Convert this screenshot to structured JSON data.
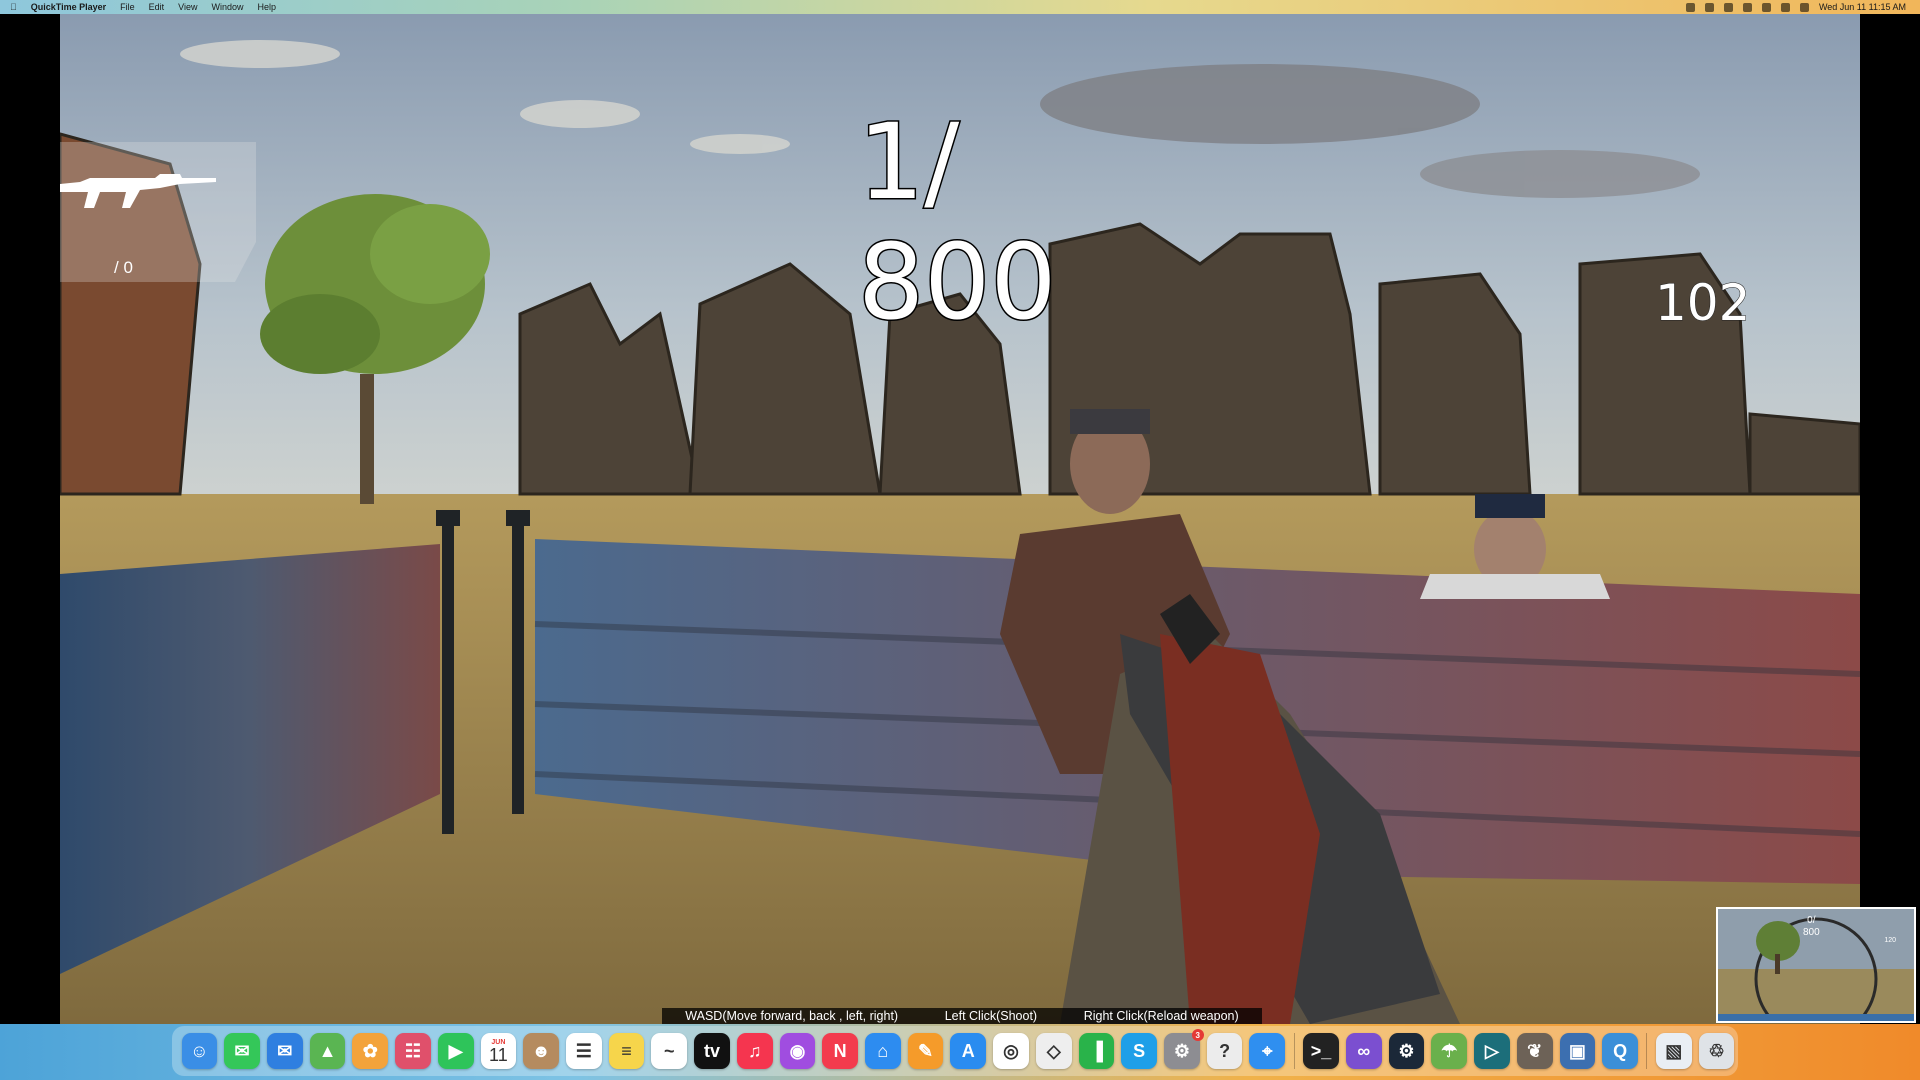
{
  "menubar": {
    "app_name": "QuickTime Player",
    "menus": [
      "File",
      "Edit",
      "View",
      "Window",
      "Help"
    ],
    "datetime": "Wed Jun 11  11:15 AM"
  },
  "hud": {
    "weapon_icon": "assault-rifle-icon",
    "ammo": "/ 0",
    "counter_line1": "1/",
    "counter_line2": "800",
    "kill_count": "102"
  },
  "controls": {
    "move": "WASD(Move forward, back , left, right)",
    "shoot": "Left Click(Shoot)",
    "reload": "Right Click(Reload weapon)"
  },
  "thumbnail": {
    "counter_line1": "0/",
    "counter_line2": "800",
    "kill_count": "120"
  },
  "dock": {
    "calendar_month": "JUN",
    "calendar_day": "11",
    "settings_badge": "3",
    "apps": [
      {
        "name": "finder-icon",
        "color": "#3a8ee6"
      },
      {
        "name": "messages-icon",
        "color": "#34c759"
      },
      {
        "name": "mail-icon",
        "color": "#2f7fe0"
      },
      {
        "name": "maps-icon",
        "color": "#5ab552"
      },
      {
        "name": "photos-icon",
        "color": "#f3a33b"
      },
      {
        "name": "launchpad-icon",
        "color": "#e0506b"
      },
      {
        "name": "facetime-icon",
        "color": "#2ec45a"
      },
      {
        "name": "calendar-icon",
        "color": "#ffffff"
      },
      {
        "name": "contacts-icon",
        "color": "#b58b5f"
      },
      {
        "name": "reminders-icon",
        "color": "#ffffff"
      },
      {
        "name": "notes-icon",
        "color": "#f6d54b"
      },
      {
        "name": "freeform-icon",
        "color": "#ffffff"
      },
      {
        "name": "apple-tv-icon",
        "color": "#111111"
      },
      {
        "name": "music-icon",
        "color": "#f5354f"
      },
      {
        "name": "podcasts-icon",
        "color": "#a04de0"
      },
      {
        "name": "news-icon",
        "color": "#f33b4d"
      },
      {
        "name": "keynote-icon",
        "color": "#2d8cf0"
      },
      {
        "name": "pages-icon",
        "color": "#f59b2a"
      },
      {
        "name": "app-store-icon",
        "color": "#2a8cf0"
      },
      {
        "name": "chrome-icon",
        "color": "#ffffff"
      },
      {
        "name": "unity-icon",
        "color": "#eeeeee"
      },
      {
        "name": "numbers-icon",
        "color": "#29b34a"
      },
      {
        "name": "skype-icon",
        "color": "#1e9fe8"
      },
      {
        "name": "system-settings-icon",
        "color": "#8d8d92"
      },
      {
        "name": "help-icon",
        "color": "#ececec"
      },
      {
        "name": "safari-icon",
        "color": "#2f8ff0"
      },
      {
        "name": "terminal-icon",
        "color": "#222222"
      },
      {
        "name": "visual-studio-icon",
        "color": "#7b4fd0"
      },
      {
        "name": "steam-icon",
        "color": "#1b2838"
      },
      {
        "name": "android-studio-icon",
        "color": "#6ab04c"
      },
      {
        "name": "cursor-app-icon",
        "color": "#1c6e7a"
      },
      {
        "name": "gimp-icon",
        "color": "#6d6257"
      },
      {
        "name": "screen-sharing-icon",
        "color": "#3c6fb0"
      },
      {
        "name": "quicktime-icon",
        "color": "#3b8fd8"
      },
      {
        "name": "preview-icon",
        "color": "#e9eef4"
      },
      {
        "name": "trash-icon",
        "color": "#dfe3e7"
      }
    ]
  }
}
